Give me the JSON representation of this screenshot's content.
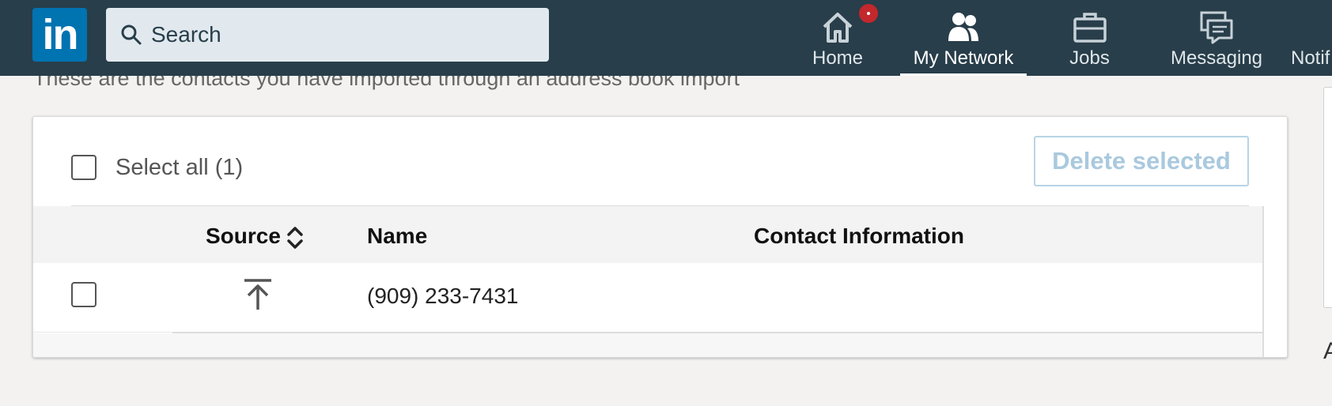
{
  "topnav": {
    "logo": "in",
    "search": {
      "placeholder": "Search"
    },
    "items": [
      {
        "label": "Home",
        "icon": "home-icon",
        "notification": true
      },
      {
        "label": "My Network",
        "icon": "network-icon",
        "active": true
      },
      {
        "label": "Jobs",
        "icon": "briefcase-icon"
      },
      {
        "label": "Messaging",
        "icon": "messaging-icon"
      },
      {
        "label": "Notif",
        "icon": "bell-icon"
      }
    ],
    "colors": {
      "background": "#283e4a",
      "logo": "#0073b1",
      "badge": "#c2282c"
    }
  },
  "page": {
    "subtitle": "These are the contacts you have imported through an address book import",
    "right_edge_text": "A"
  },
  "contacts_card": {
    "select_all_label": "Select all (1)",
    "delete_button": "Delete selected",
    "columns": [
      "Source",
      "Name",
      "Contact Information"
    ],
    "rows": [
      {
        "source_icon": "upload-icon",
        "name": "(909) 233-7431",
        "contact_info": ""
      }
    ]
  }
}
